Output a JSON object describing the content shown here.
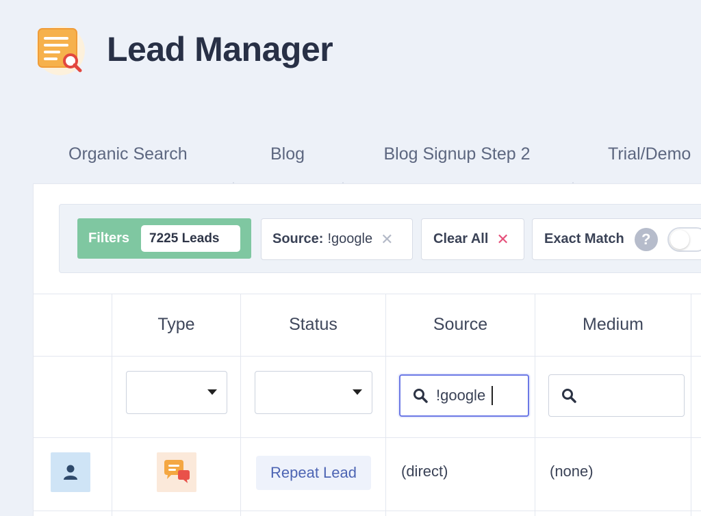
{
  "app": {
    "title": "Lead Manager"
  },
  "tabs": [
    {
      "label": "Organic Search"
    },
    {
      "label": "Blog"
    },
    {
      "label": "Blog Signup Step 2"
    },
    {
      "label": "Trial/Demo"
    }
  ],
  "filters": {
    "label": "Filters",
    "leads_count": "7225 Leads",
    "source_chip": {
      "key": "Source:",
      "value": "!google"
    },
    "clear_all": "Clear All",
    "exact_match": "Exact Match",
    "help_symbol": "?",
    "exact_match_enabled": false
  },
  "table": {
    "columns": [
      "Type",
      "Status",
      "Source",
      "Medium"
    ],
    "source_search": {
      "value": "!google"
    },
    "medium_search": {
      "value": ""
    },
    "rows": [
      {
        "status": "Repeat Lead",
        "source": "(direct)",
        "medium": "(none)"
      }
    ]
  },
  "colors": {
    "accent_green": "#7fc7a1",
    "accent_blue": "#6b78e5",
    "clear_x": "#e5507a",
    "badge_text": "#4c64b3"
  },
  "icons": [
    "lead-manager-logo-icon",
    "close-icon",
    "help-icon",
    "search-icon",
    "chevron-down-icon",
    "user-icon",
    "chat-icon"
  ]
}
